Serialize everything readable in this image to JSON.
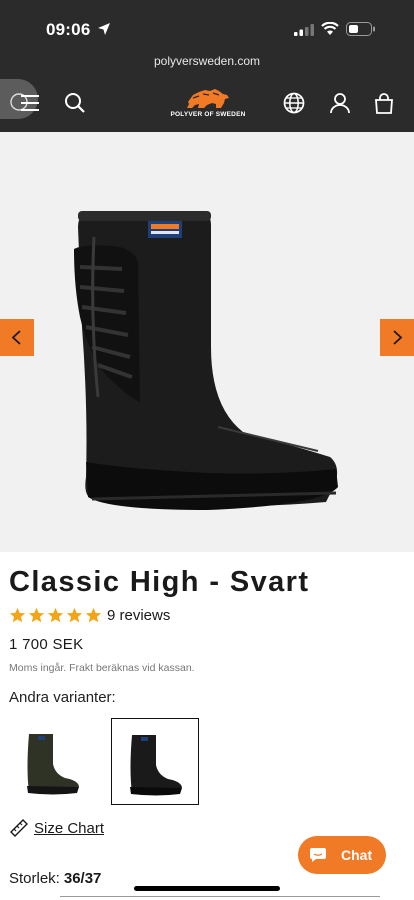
{
  "status_bar": {
    "time": "09:06"
  },
  "browser": {
    "url": "polyversweden.com"
  },
  "header": {
    "logo_text": "POLYVER OF SWEDEN",
    "brand_color": "#f07a26"
  },
  "product": {
    "title": "Classic High - Svart",
    "rating": {
      "stars": 5,
      "reviews_label": "9 reviews"
    },
    "price": "1 700 SEK",
    "tax_note": "Moms ingår. Frakt beräknas vid kassan.",
    "variants_label": "Andra varianter:",
    "variants": [
      {
        "color": "olive-green",
        "selected": false
      },
      {
        "color": "black",
        "selected": true
      }
    ],
    "size_chart_label": "Size Chart",
    "size_label": "Storlek:",
    "size_value": "36/37"
  },
  "chat": {
    "label": "Chat"
  },
  "icons": [
    "location-arrow-icon",
    "signal-icon",
    "wifi-icon",
    "battery-icon",
    "menu-icon",
    "search-icon",
    "globe-icon",
    "account-icon",
    "cart-icon",
    "chevron-left-icon",
    "chevron-right-icon",
    "star-icon",
    "ruler-icon",
    "chat-bubble-icon"
  ]
}
